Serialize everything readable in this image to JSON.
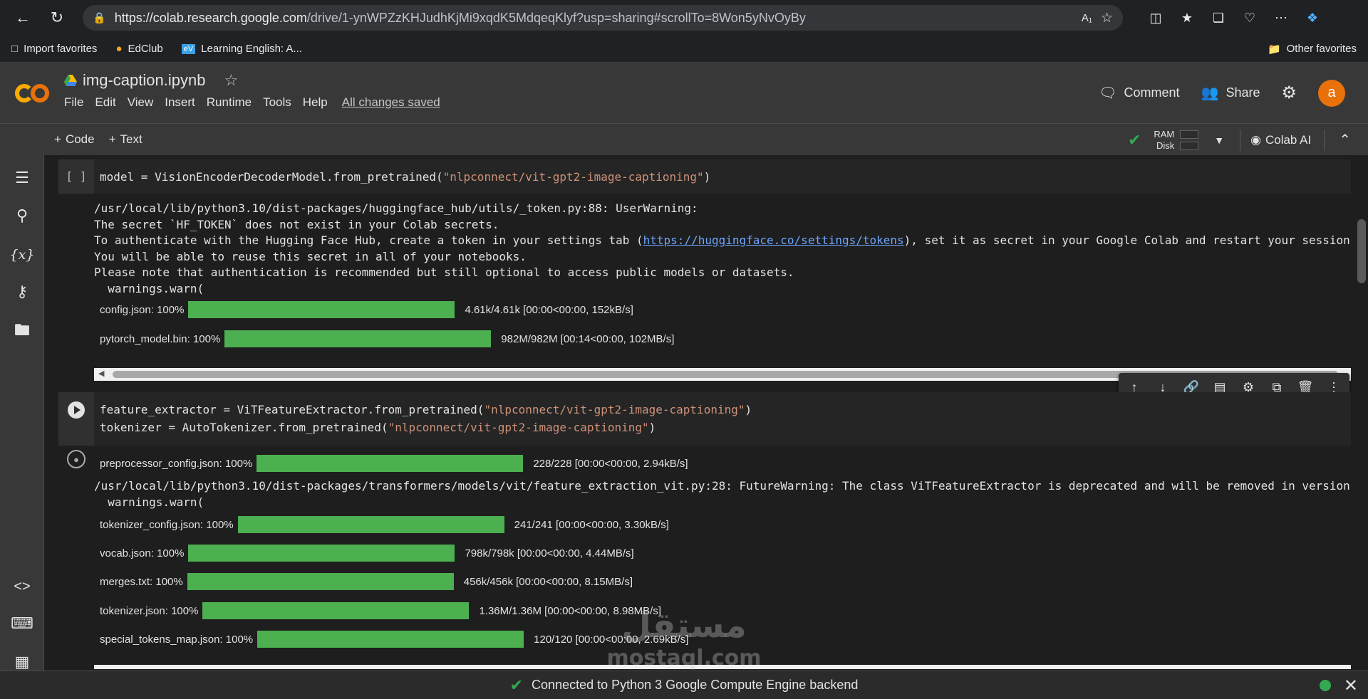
{
  "browser": {
    "url_host": "https://colab.research.google.com",
    "url_path": "/drive/1-ynWPZzKHJudhKjMi9xqdK5MdqeqKlyf?usp=sharing#scrollTo=8Won5yNvOyBy",
    "bookmarks": [
      "Import favorites",
      "EdClub",
      "Learning English: A..."
    ],
    "other_favorites": "Other favorites"
  },
  "colab": {
    "title": "img-caption.ipynb",
    "menu": [
      "File",
      "Edit",
      "View",
      "Insert",
      "Runtime",
      "Tools",
      "Help"
    ],
    "saved_status": "All changes saved",
    "comment_label": "Comment",
    "share_label": "Share",
    "avatar_letter": "a",
    "add_code": "Code",
    "add_text": "Text",
    "ram_label": "RAM",
    "disk_label": "Disk",
    "colab_ai": "Colab AI"
  },
  "cell1": {
    "gutter": "[ ]",
    "code_prefix": "model = VisionEncoderDecoderModel.from_pretrained(",
    "code_string": "\"nlpconnect/vit-gpt2-image-captioning\"",
    "code_suffix": ")",
    "output_lines": [
      "/usr/local/lib/python3.10/dist-packages/huggingface_hub/utils/_token.py:88: UserWarning:",
      "The secret `HF_TOKEN` does not exist in your Colab secrets."
    ],
    "auth_prefix": "To authenticate with the Hugging Face Hub, create a token in your settings tab (",
    "auth_link": "https://huggingface.co/settings/tokens",
    "auth_suffix": "), set it as secret in your Google Colab and restart your session",
    "output_lines_2": [
      "You will be able to reuse this secret in all of your notebooks.",
      "Please note that authentication is recommended but still optional to access public models or datasets.",
      "  warnings.warn("
    ],
    "progress": [
      {
        "name": "config.json:",
        "pct": "100%",
        "stats": "4.61k/4.61k  [00:00<00:00,  152kB/s]"
      },
      {
        "name": "pytorch_model.bin:",
        "pct": "100%",
        "stats": "982M/982M  [00:14<00:00,  102MB/s]"
      }
    ]
  },
  "cell2": {
    "line1_prefix": "feature_extractor = ViTFeatureExtractor.from_pretrained(",
    "line1_string": "\"nlpconnect/vit-gpt2-image-captioning\"",
    "line1_suffix": ")",
    "line2_prefix": "tokenizer = AutoTokenizer.from_pretrained(",
    "line2_string": "\"nlpconnect/vit-gpt2-image-captioning\"",
    "line2_suffix": ")",
    "warning_line": "/usr/local/lib/python3.10/dist-packages/transformers/models/vit/feature_extraction_vit.py:28: FutureWarning: The class ViTFeatureExtractor is deprecated and will be removed in version",
    "warning_line2": "  warnings.warn(",
    "progress": [
      {
        "name": "preprocessor_config.json:",
        "pct": "100%",
        "stats": "228/228  [00:00<00:00,  2.94kB/s]"
      },
      {
        "name": "tokenizer_config.json:",
        "pct": "100%",
        "stats": "241/241  [00:00<00:00,  3.30kB/s]"
      },
      {
        "name": "vocab.json:",
        "pct": "100%",
        "stats": "798k/798k  [00:00<00:00,  4.44MB/s]"
      },
      {
        "name": "merges.txt:",
        "pct": "100%",
        "stats": "456k/456k  [00:00<00:00,  8.15MB/s]"
      },
      {
        "name": "tokenizer.json:",
        "pct": "100%",
        "stats": "1.36M/1.36M  [00:00<00:00,  8.98MB/s]"
      },
      {
        "name": "special_tokens_map.json:",
        "pct": "100%",
        "stats": "120/120  [00:00<00:00,  2.69kB/s]"
      }
    ]
  },
  "status": {
    "text": "Connected to Python 3 Google Compute Engine backend"
  },
  "watermark": {
    "arabic": "مستقل",
    "latin": "mostaql.com"
  },
  "colors": {
    "progress": "#4caf50",
    "string": "#ce9178",
    "link": "#6ea6ff",
    "connected": "#34a853",
    "avatar": "#e8710a"
  }
}
